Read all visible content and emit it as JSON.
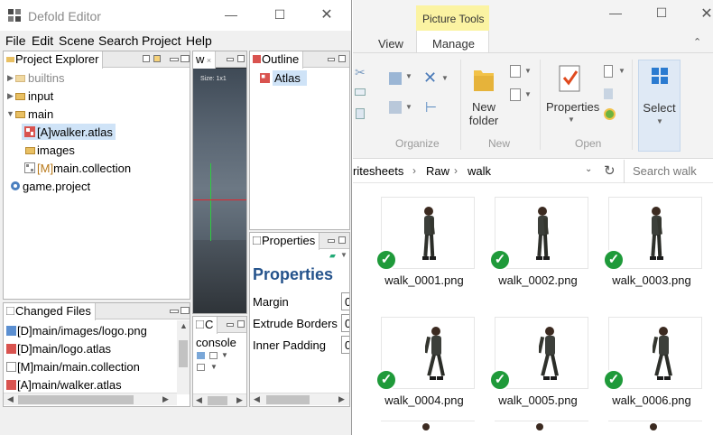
{
  "editor": {
    "title": "Defold Editor",
    "menu": [
      "File",
      "Edit",
      "Scene",
      "Search",
      "Project",
      "Help"
    ],
    "project_explorer": {
      "tab": "Project Explorer",
      "items": [
        {
          "label": "builtins",
          "dim": true
        },
        {
          "label": "input",
          "dim": false
        },
        {
          "label": "main",
          "dim": false
        },
        {
          "label": "[A]walker.atlas",
          "dim": false
        },
        {
          "label": "images",
          "dim": false
        },
        {
          "label": "[M]main.collection",
          "dim": false
        },
        {
          "label": "game.project",
          "dim": false
        }
      ]
    },
    "scene_tab": "w",
    "scene_size": "Size: 1x1",
    "outline": {
      "tab": "Outline",
      "item": "Atlas"
    },
    "properties": {
      "tab": "Properties",
      "heading": "Properties",
      "fields": [
        {
          "label": "Margin",
          "value": "0"
        },
        {
          "label": "Extrude Borders",
          "value": "0"
        },
        {
          "label": "Inner Padding",
          "value": "0"
        }
      ]
    },
    "changed_files": {
      "tab": "Changed Files",
      "items": [
        "[D]main/images/logo.png",
        "[D]main/logo.atlas",
        "[M]main/main.collection",
        "[A]main/walker.atlas"
      ]
    },
    "console": {
      "tab": "C",
      "label": "console"
    }
  },
  "explorer": {
    "picture_tools": "Picture Tools",
    "tabs": [
      "View",
      "Manage"
    ],
    "groups": [
      "Organize",
      "New",
      "Open"
    ],
    "new_folder": [
      "New",
      "folder"
    ],
    "properties_label": "Properties",
    "select_label": "Select",
    "breadcrumb": [
      "ritesheets",
      "Raw",
      "walk"
    ],
    "search_placeholder": "Search walk",
    "files": [
      "walk_0001.png",
      "walk_0002.png",
      "walk_0003.png",
      "walk_0004.png",
      "walk_0005.png",
      "walk_0006.png"
    ],
    "accent": "#1f9a3a",
    "tools_highlight": "#fbf3a2"
  }
}
